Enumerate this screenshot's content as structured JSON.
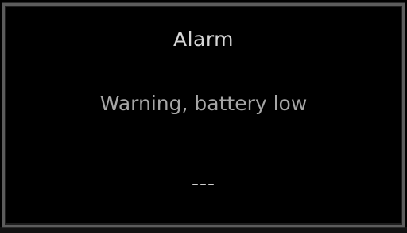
{
  "alarm_dialog": {
    "title": "Alarm",
    "message": "Warning, battery low",
    "action_label": "---"
  },
  "colors": {
    "background": "#000000",
    "border": "#5c5c5c",
    "title_text": "#d6d6d6",
    "message_text": "#a6a6a6"
  }
}
